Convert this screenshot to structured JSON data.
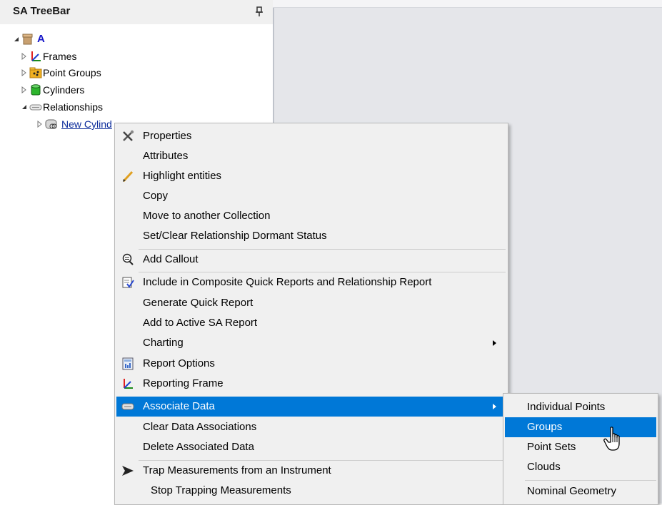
{
  "treebar": {
    "title": "SA TreeBar",
    "pin_icon": "pin-icon",
    "root": {
      "label": "A",
      "icon": "collection-icon",
      "expanded": true
    },
    "items": [
      {
        "label": "Frames",
        "icon": "frames-icon",
        "expanded": false
      },
      {
        "label": "Point Groups",
        "icon": "point-groups-icon",
        "expanded": false
      },
      {
        "label": "Cylinders",
        "icon": "cylinder-icon",
        "expanded": false
      },
      {
        "label": "Relationships",
        "icon": "relationship-icon",
        "expanded": true
      },
      {
        "label": "New Cylind",
        "icon": "relationship-item-icon",
        "expanded": false
      }
    ]
  },
  "context_menu": {
    "items": [
      {
        "label": "Properties",
        "icon": "tools-icon"
      },
      {
        "label": "Attributes",
        "icon": ""
      },
      {
        "label": "Highlight entities",
        "icon": "pencil-icon"
      },
      {
        "label": "Copy",
        "icon": ""
      },
      {
        "label": "Move to another Collection",
        "icon": ""
      },
      {
        "label": "Set/Clear Relationship Dormant Status",
        "icon": ""
      },
      {
        "label": "Add Callout",
        "icon": "callout-icon"
      },
      {
        "label": "Include in Composite Quick Reports and Relationship Report",
        "icon": "report-check-icon"
      },
      {
        "label": "Generate Quick Report",
        "icon": ""
      },
      {
        "label": "Add to Active SA Report",
        "icon": ""
      },
      {
        "label": "Charting",
        "icon": "",
        "submenu": true
      },
      {
        "label": "Report Options",
        "icon": "report-options-icon"
      },
      {
        "label": "Reporting Frame",
        "icon": "frame-axes-icon"
      },
      {
        "label": "Associate Data",
        "icon": "link-icon",
        "submenu": true,
        "highlighted": true
      },
      {
        "label": "Clear Data Associations",
        "icon": ""
      },
      {
        "label": "Delete Associated Data",
        "icon": ""
      },
      {
        "label": "Trap Measurements from an Instrument",
        "icon": "arrow-icon"
      },
      {
        "label": "Stop Trapping Measurements",
        "icon": ""
      }
    ]
  },
  "submenu": {
    "items": [
      {
        "label": "Individual Points"
      },
      {
        "label": "Groups",
        "highlighted": true
      },
      {
        "label": "Point Sets"
      },
      {
        "label": "Clouds"
      },
      {
        "label": "Nominal Geometry"
      }
    ]
  },
  "colors": {
    "highlight": "#0078d7",
    "menu_bg": "#f0f0f0",
    "viewport_bg": "#e5e6ea"
  }
}
